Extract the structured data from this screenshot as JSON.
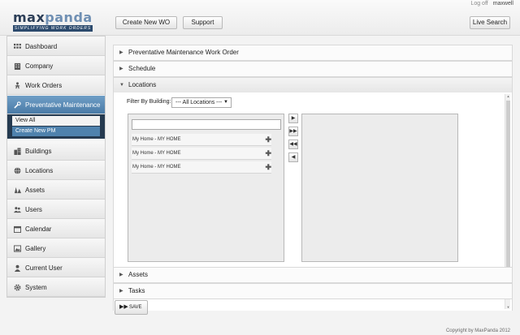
{
  "brand": {
    "name_part1": "max",
    "name_part2": "panda",
    "tagline": "SIMPLIFYING WORK ORDERS"
  },
  "header": {
    "create_wo_label": "Create New WO",
    "support_label": "Support",
    "live_search_label": "Live Search",
    "logoff_label": "Log off",
    "username": "maxwell"
  },
  "sidebar": {
    "items": [
      {
        "label": "Dashboard",
        "icon": "grid-icon"
      },
      {
        "label": "Company",
        "icon": "building-icon"
      },
      {
        "label": "Work Orders",
        "icon": "worker-icon"
      },
      {
        "label": "Preventative Maintenance",
        "icon": "wrench-icon"
      },
      {
        "label": "Buildings",
        "icon": "building-icon"
      },
      {
        "label": "Locations",
        "icon": "globe-icon"
      },
      {
        "label": "Assets",
        "icon": "assets-icon"
      },
      {
        "label": "Users",
        "icon": "users-icon"
      },
      {
        "label": "Calendar",
        "icon": "calendar-icon"
      },
      {
        "label": "Gallery",
        "icon": "image-icon"
      },
      {
        "label": "Current User",
        "icon": "user-icon"
      },
      {
        "label": "System",
        "icon": "gear-icon"
      }
    ],
    "submenu": [
      "View All",
      "Create New PM"
    ]
  },
  "sections": {
    "pm_work_order": "Preventative Maintenance Work Order",
    "schedule": "Schedule",
    "locations": "Locations",
    "assets": "Assets",
    "tasks": "Tasks"
  },
  "locations": {
    "filter_label": "Filter By Building:",
    "filter_value": "--- All Locations ---",
    "search_value": "",
    "rows": [
      "My Home - MY HOME",
      "My Home - MY HOME",
      "My Home - MY HOME"
    ],
    "move_buttons": [
      "move-one-right",
      "move-all-right",
      "move-all-left",
      "move-one-left"
    ]
  },
  "save_label": "SAVE",
  "footer": "Copyright by MaxPanda 2012"
}
